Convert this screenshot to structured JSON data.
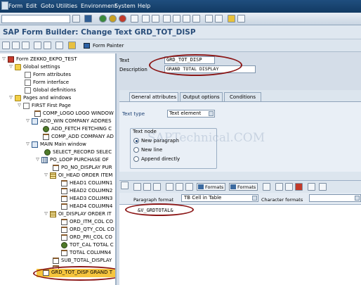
{
  "menu": {
    "items": [
      "Form",
      "Edit",
      "Goto",
      "Utilities",
      "Environment",
      "System",
      "Help"
    ]
  },
  "toolbar": {
    "command_value": ""
  },
  "title": "SAP Form Builder: Change Text GRD_TOT_DISP",
  "app_toolbar": {
    "form_painter_label": "Form Painter"
  },
  "tree": {
    "nodes": [
      "Form ZEKKO_EKPO_TEST",
      "Global settings",
      "Form attributes",
      "Form interface",
      "Global definitions",
      "Pages and windows",
      "FIRST First Page",
      "COMP_LOGO LOGO WINDOW",
      "ADD_WIN COMPANY ADDRES",
      "ADD_FETCH FETCHING C",
      "COMP_ADD COMPANY AD",
      "MAIN Main window",
      "SELECT_RECORD SELEC",
      "PO_LOOP PURCHASE OF",
      "PO_NO_DISPLAY PUR",
      "OI_HEAD ORDER ITEM",
      "HEAD1 COLUMN1",
      "HEAD2 COLUMN2",
      "HEAD3 COLUMN3",
      "HEAD4 COLUMN4",
      "OI_DISPLAY ORDER IT",
      "ORD_ITM_COL CO",
      "ORD_QTY_COL CO",
      "ORD_PRI_COL CO",
      "TOT_CAL TOTAL C",
      "TOTAL COLUMN4",
      "SUB_TOTAL_DISPLAY",
      "",
      "GRD_TOT_DISP GRAND T"
    ]
  },
  "fields": {
    "text_label": "Text",
    "text_value": "GRD_TOT_DISP",
    "desc_label": "Description",
    "desc_value": "GRAND TOTAL DISPLAY"
  },
  "tabs": [
    "General attributes",
    "Output options",
    "Conditions"
  ],
  "general": {
    "texttype_label": "Text type",
    "texttype_value": "Text element",
    "textnode_title": "Text node",
    "radio_new_paragraph": "New paragraph",
    "radio_new_line": "New line",
    "radio_append_directly": "Append directly"
  },
  "watermark": "SAPTechnical.COM",
  "editor": {
    "formats_btn1": "Formats",
    "formats_btn2": "Formats",
    "para_label": "Paragraph format",
    "para_value": "TB Cell in Table",
    "char_label": "Character formats",
    "text": "&V_GRDTOTAL&"
  },
  "colors": {
    "accent": "#2a4e7a",
    "highlight_oval": "#8b1616",
    "selection": "#f6c53e"
  }
}
